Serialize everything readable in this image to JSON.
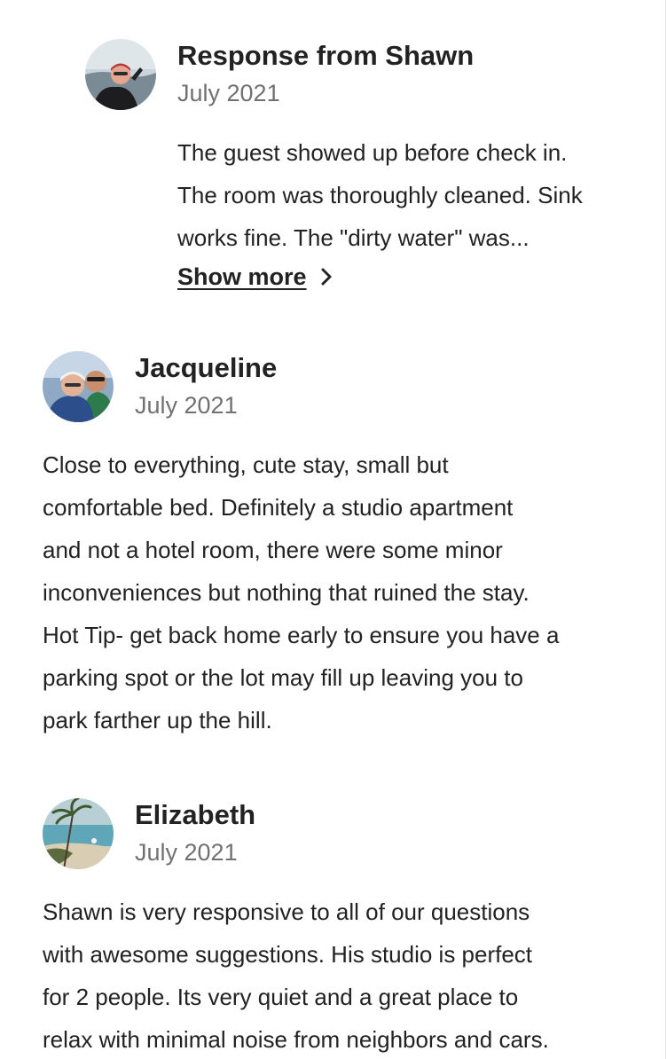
{
  "host_response": {
    "title": "Response from Shawn",
    "date": "July 2021",
    "text_lines": [
      "The guest showed up before check in.",
      "The room was thoroughly cleaned. Sink",
      "works fine. The \"dirty water\" was..."
    ],
    "show_more_label": "Show more",
    "avatar_icon": "host-avatar-photo"
  },
  "reviews": [
    {
      "name": "Jacqueline",
      "date": "July 2021",
      "avatar_icon": "reviewer-avatar-photo",
      "text_lines": [
        "Close to everything, cute stay, small but",
        "comfortable bed. Definitely a studio apartment",
        "and not a hotel room, there were some minor",
        "inconveniences but nothing that ruined the stay.",
        "Hot Tip- get back home early to ensure you have a",
        "parking spot or the lot may fill up leaving you to",
        "park farther up the hill."
      ]
    },
    {
      "name": "Elizabeth",
      "date": "July 2021",
      "avatar_icon": "reviewer-avatar-photo",
      "text_lines": [
        "Shawn is very responsive to all of our questions",
        "with awesome suggestions. His studio is perfect",
        "for 2 people. Its very quiet and a great place to",
        "relax with minimal noise from neighbors and cars."
      ]
    }
  ],
  "colors": {
    "primary_text": "#222222",
    "secondary_text": "#717171",
    "background": "#ffffff"
  }
}
